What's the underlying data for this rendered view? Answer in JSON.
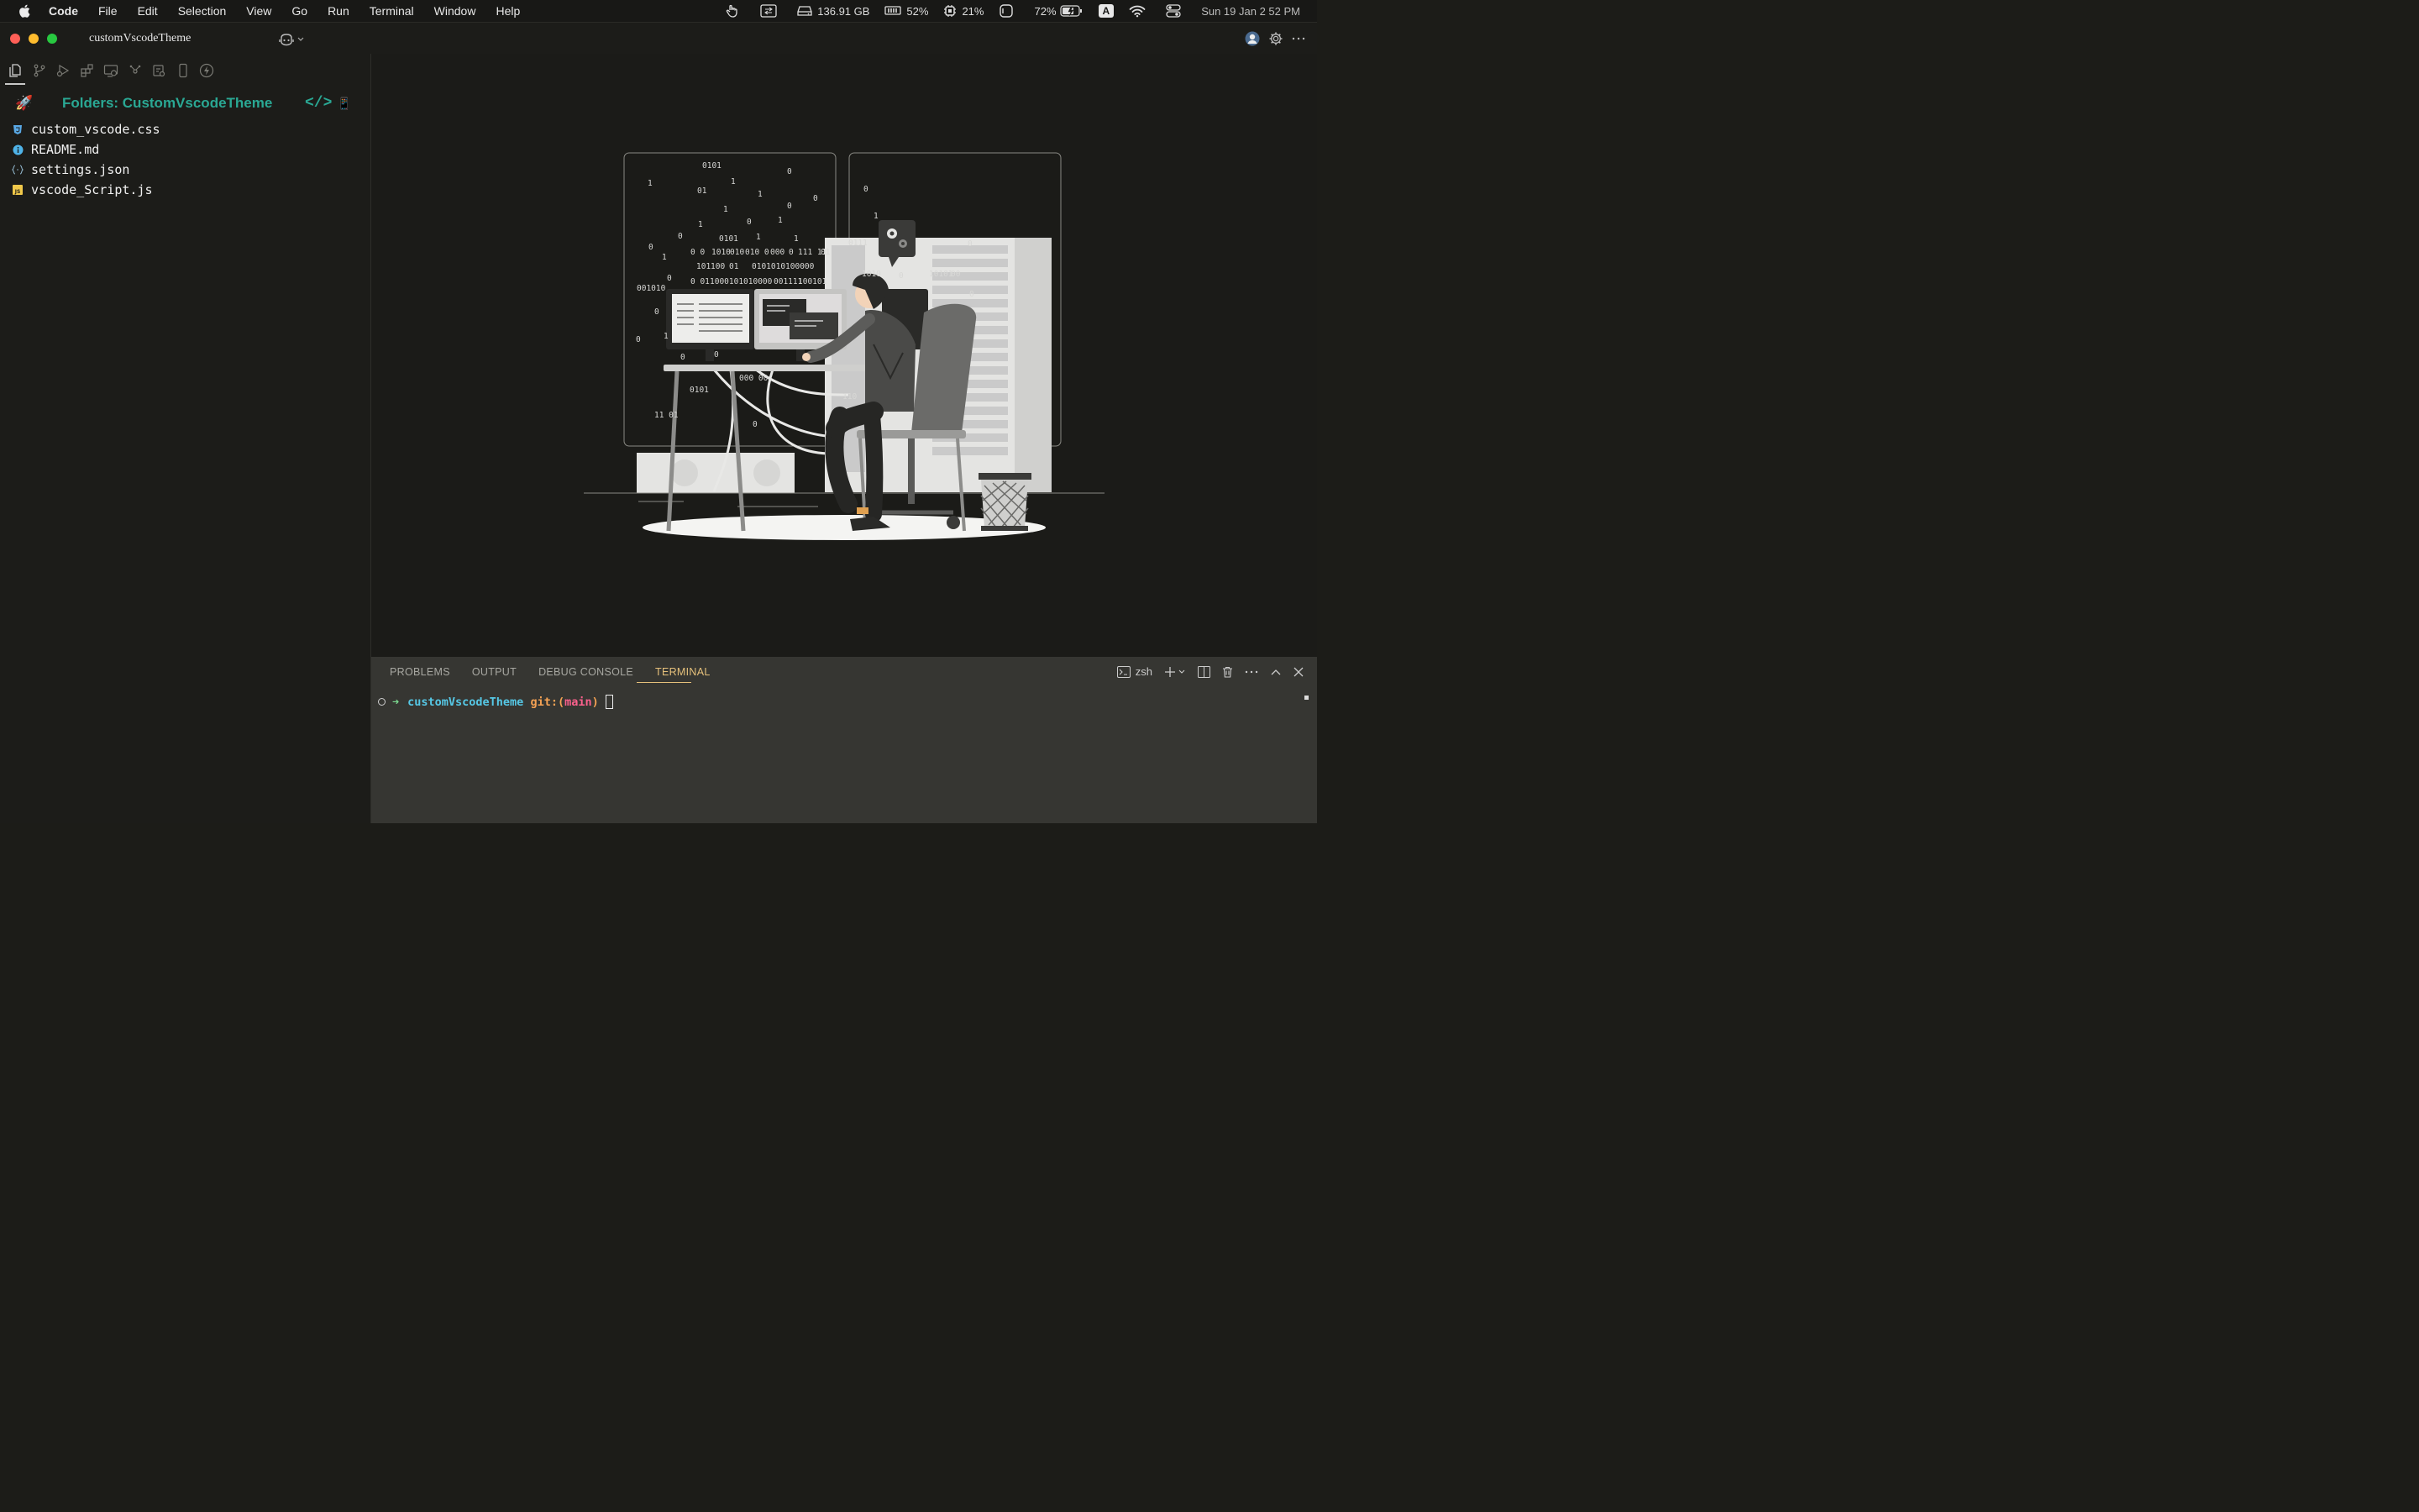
{
  "menubar": {
    "app": "Code",
    "items": [
      "File",
      "Edit",
      "Selection",
      "View",
      "Go",
      "Run",
      "Terminal",
      "Window",
      "Help"
    ],
    "status": {
      "disk": "136.91 GB",
      "memory": "52%",
      "cpu": "21%",
      "battery": "72%",
      "input": "A",
      "clock": "Sun 19 Jan  2 52 PM"
    }
  },
  "window": {
    "title": "customVscodeTheme"
  },
  "sidebar": {
    "folder_title": "Folders: CustomVscodeTheme",
    "code_tag": "</>",
    "rocket": "🚀",
    "phone": "📱",
    "files": [
      {
        "name": "custom_vscode.css",
        "icon": "css-shield-icon",
        "color": "#5aa9e6"
      },
      {
        "name": "README.md",
        "icon": "info-icon",
        "color": "#4fb3e8"
      },
      {
        "name": "settings.json",
        "icon": "json-braces-icon",
        "color": "#8fb3c8"
      },
      {
        "name": "vscode_Script.js",
        "icon": "js-icon",
        "color": "#f0c84a"
      }
    ]
  },
  "panel": {
    "tabs": [
      "PROBLEMS",
      "OUTPUT",
      "DEBUG CONSOLE",
      "TERMINAL"
    ],
    "active_tab": "TERMINAL",
    "shell": "zsh",
    "terminal": {
      "arrow": "➜",
      "dir": "customVscodeTheme",
      "git_label": "git:(",
      "branch": "main",
      "git_close": ")"
    }
  },
  "illustration": {
    "binary": [
      "0101",
      "1",
      "1",
      "01",
      "1",
      "0",
      "1",
      "0",
      "0",
      "1",
      "0",
      "1",
      "0101",
      "0",
      "1",
      "1",
      "0",
      "1",
      "0 0",
      "1010",
      "010",
      "010 0",
      "000",
      "0",
      "111 11",
      "01",
      "101",
      "100",
      "01",
      "0101010100000",
      "0",
      "0 01",
      "1000101010000",
      "001111",
      "100101",
      "001010",
      "0",
      "1",
      "0",
      "0",
      "0",
      "0101",
      "11 01",
      "0",
      "0",
      "0111",
      "0",
      "1",
      "10101",
      "00",
      "0",
      "0",
      "1010",
      "000 00",
      "110"
    ]
  }
}
